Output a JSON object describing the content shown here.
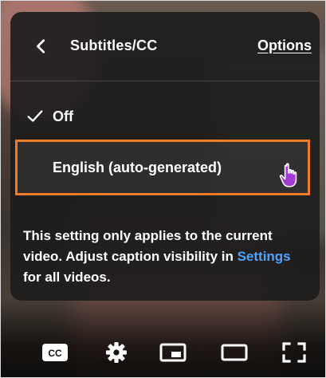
{
  "menu": {
    "title": "Subtitles/CC",
    "options_label": "Options",
    "items": [
      {
        "label": "Off",
        "selected": true
      },
      {
        "label": "English (auto-generated)",
        "selected": false,
        "highlighted": true
      }
    ],
    "note": {
      "text_before": "This setting only applies to the current video. Adjust caption visibility in ",
      "link_text": "Settings",
      "text_after": " for all videos."
    }
  },
  "controls": {
    "cc_label": "CC",
    "icons": [
      "cc-icon",
      "gear-icon",
      "miniplayer-icon",
      "theater-mode-icon",
      "fullscreen-icon"
    ]
  },
  "colors": {
    "accent_outline": "#f07b2a",
    "link": "#4ea3ff",
    "cursor_fill": "#a43ad6"
  }
}
